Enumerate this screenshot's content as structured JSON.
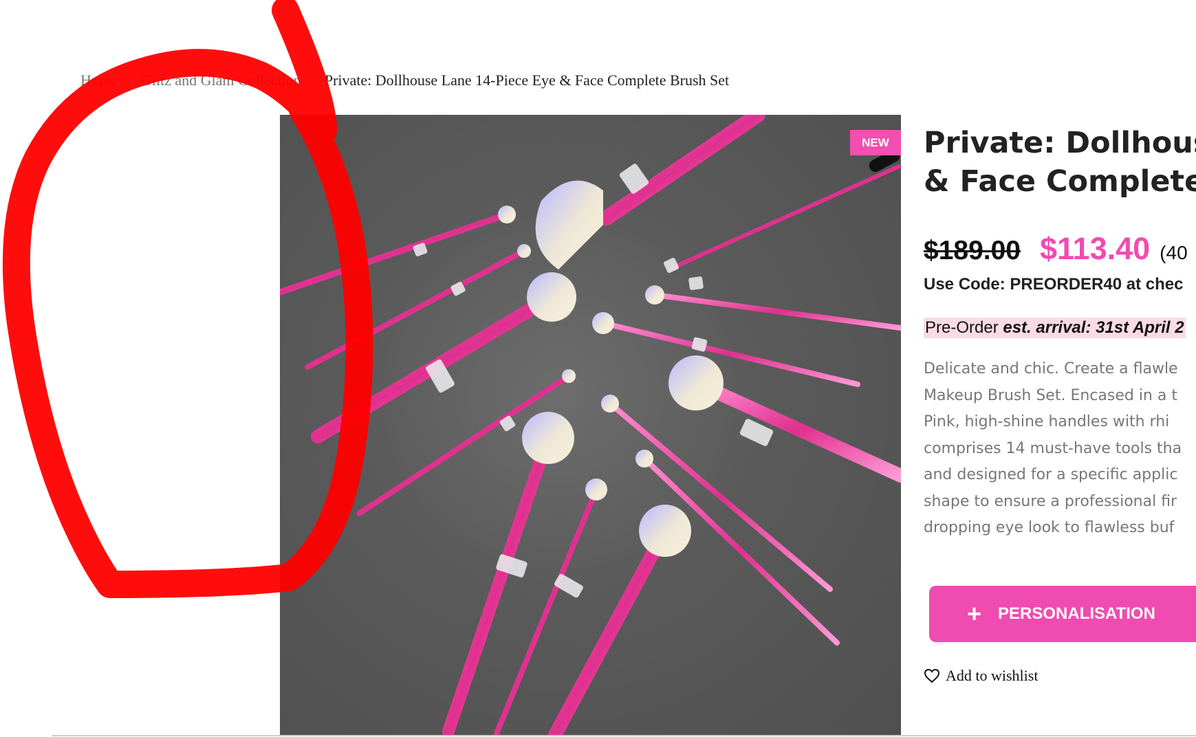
{
  "breadcrumb": {
    "home": "Home",
    "category": "Glitz and Glam Collection",
    "separator": "/",
    "current": "Private: Dollhouse Lane 14-Piece Eye & Face Complete Brush Set"
  },
  "product": {
    "badge": "NEW",
    "title_line1": "Private: Dollhouse",
    "title_line2": "& Face Complete",
    "price_old": "$189.00",
    "price_new": "$113.40",
    "discount": "(40",
    "code_line": "Use Code: PREORDER40 at chec",
    "preorder_label": "Pre-Order",
    "preorder_arrival": "est. arrival: 31st April 2",
    "description_lines": [
      "Delicate and chic. Create a flawle",
      "Makeup Brush Set. Encased in a t",
      "Pink, high-shine handles with rhi",
      "comprises 14 must-have tools tha",
      "and designed for a specific applic",
      "shape to ensure a professional fir",
      "dropping eye look to flawless buf"
    ],
    "personalisation_label": "PERSONALISATION",
    "personalisation_icon": "+",
    "wishlist_label": "Add to wishlist"
  },
  "icons": {
    "wishlist": "heart-icon",
    "personalisation": "plus-icon"
  },
  "colors": {
    "accent": "#f04bb0",
    "badge": "#f24fb0",
    "preorder_bg": "#f9dbe5",
    "annotation": "#ff0000"
  }
}
